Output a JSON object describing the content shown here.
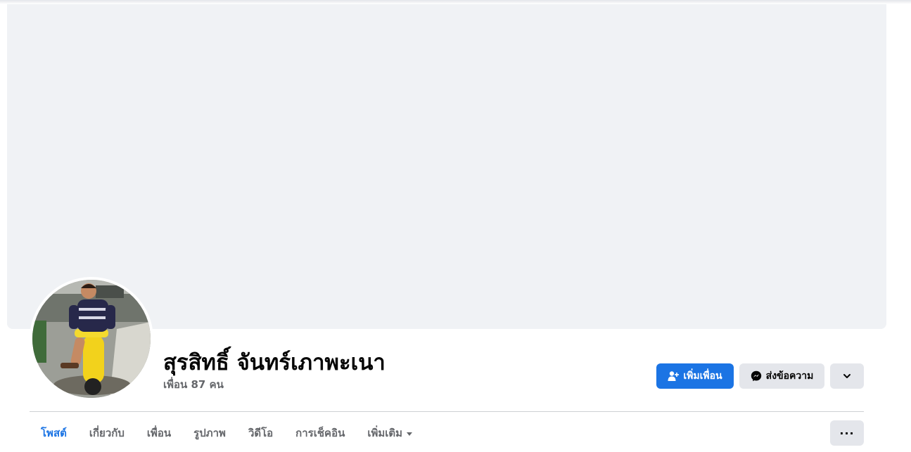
{
  "profile": {
    "name": "สุรสิทธิ์ จันทร์เภาพะเนา",
    "friends_count": "เพื่อน 87 คน"
  },
  "actions": {
    "add_friend_label": "เพิ่มเพื่อน",
    "message_label": "ส่งข้อความ"
  },
  "tabs": [
    {
      "label": "โพสต์",
      "active": true
    },
    {
      "label": "เกี่ยวกับ",
      "active": false
    },
    {
      "label": "เพื่อน",
      "active": false
    },
    {
      "label": "รูปภาพ",
      "active": false
    },
    {
      "label": "วิดีโอ",
      "active": false
    },
    {
      "label": "การเช็คอิน",
      "active": false
    },
    {
      "label": "เพิ่มเติม",
      "active": false
    }
  ],
  "icons": {
    "add_friend": "person-plus-icon",
    "message": "messenger-icon",
    "more": "chevron-down-icon",
    "tabs_more": "ellipsis-icon",
    "tab_dropdown": "caret-down-icon"
  },
  "colors": {
    "accent": "#1b74e4",
    "cover_bg": "#f0f2f5",
    "secondary_button": "#e4e6eb",
    "muted_text": "#65676b"
  }
}
